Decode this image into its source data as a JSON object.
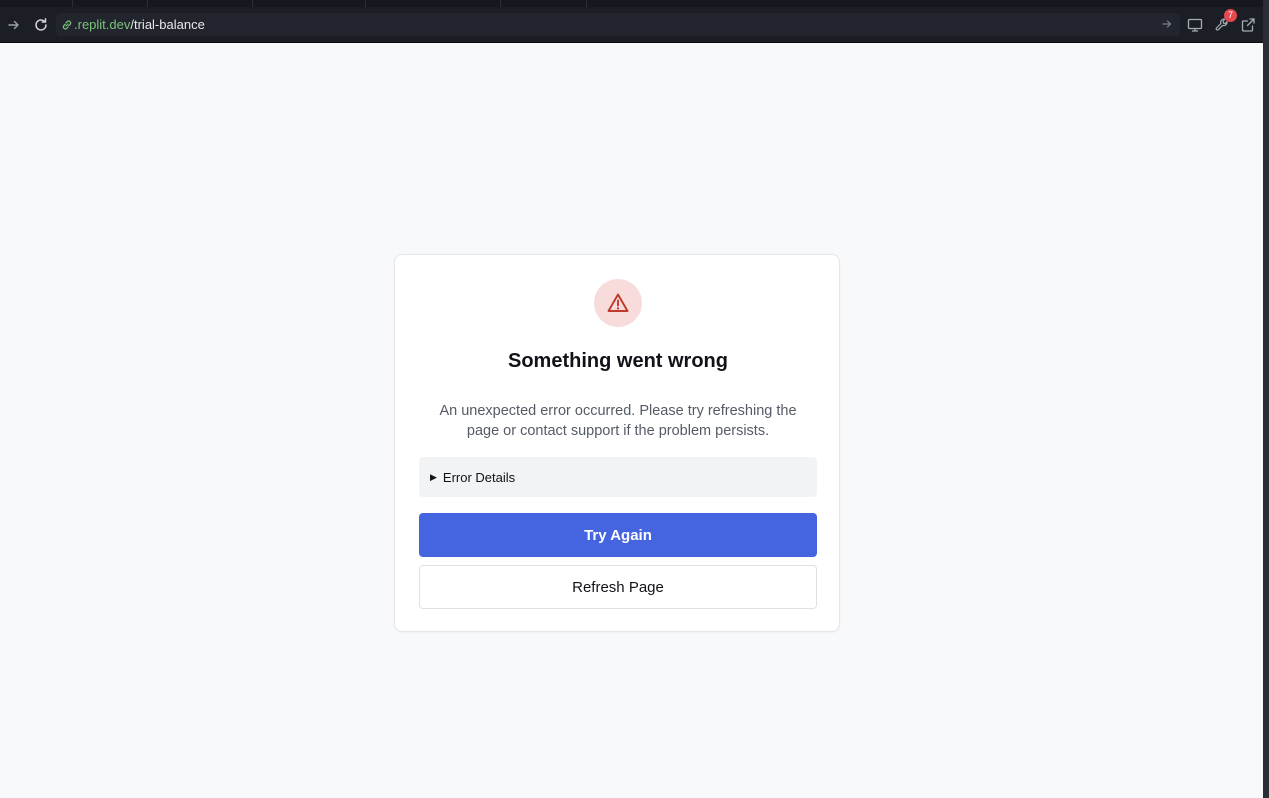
{
  "browser": {
    "url_domain": ".replit.dev",
    "url_path": "/trial-balance",
    "notification_count": "7",
    "icons": {
      "forward": "arrow-right-icon",
      "reload": "reload-icon",
      "link": "link-icon",
      "go": "arrow-right-icon",
      "devices": "monitor-icon",
      "tools": "wrench-icon",
      "external": "external-link-icon"
    },
    "colors": {
      "domain": "#79c47a",
      "badge": "#e5484d"
    }
  },
  "error_card": {
    "icon": "warning-triangle-icon",
    "title": "Something went wrong",
    "description": "An unexpected error occurred. Please try refreshing the page or contact support if the problem persists.",
    "details_label": "Error Details",
    "try_again_label": "Try Again",
    "refresh_label": "Refresh Page",
    "colors": {
      "primary": "#4565e0",
      "warning": "#c0392b",
      "warning_bg": "#f8dcdc"
    }
  }
}
